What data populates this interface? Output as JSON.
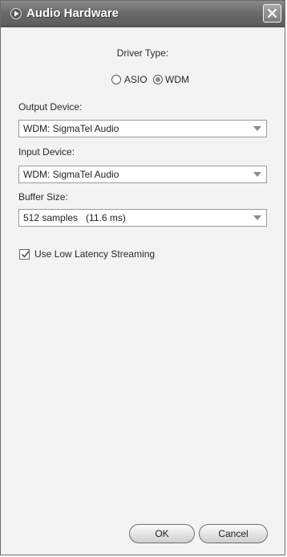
{
  "window": {
    "title": "Audio Hardware",
    "icons": {
      "title": "play-arrow-icon",
      "close": "close-x-icon"
    }
  },
  "driver": {
    "label": "Driver Type:",
    "options": [
      {
        "label": "ASIO",
        "selected": false
      },
      {
        "label": "WDM",
        "selected": true
      }
    ]
  },
  "output_device": {
    "label": "Output Device:",
    "value": "WDM: SigmaTel Audio"
  },
  "input_device": {
    "label": "Input Device:",
    "value": "WDM: SigmaTel Audio"
  },
  "buffer": {
    "label": "Buffer Size:",
    "value": "512 samples   (11.6 ms)"
  },
  "low_latency": {
    "label": "Use Low Latency Streaming",
    "checked": true
  },
  "buttons": {
    "ok": "OK",
    "cancel": "Cancel"
  },
  "colors": {
    "titlebar": "#6b6b6b",
    "panel": "#f3f3f3"
  }
}
